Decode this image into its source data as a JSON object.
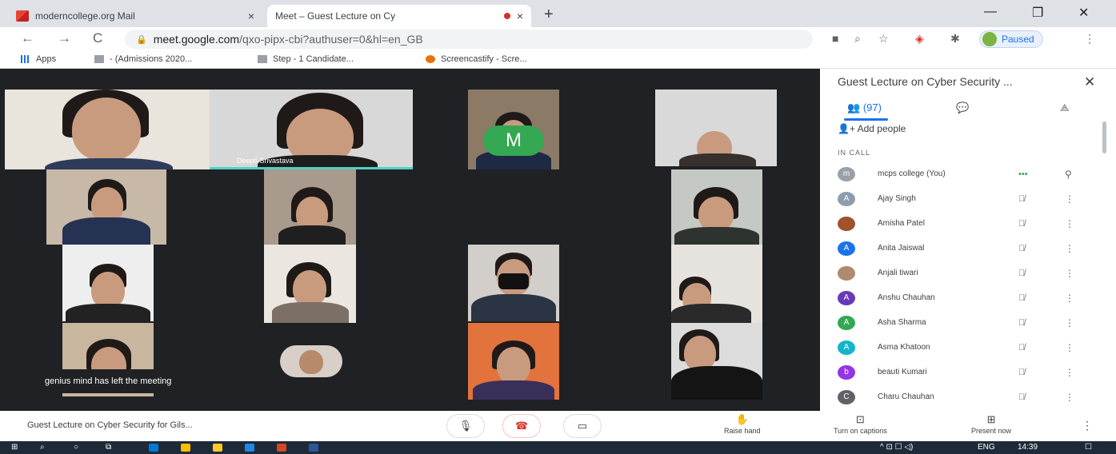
{
  "browser": {
    "tabs": [
      {
        "title": "moderncollege.org Mail",
        "close": "×"
      },
      {
        "title": "Meet – Guest Lecture on Cy",
        "close": "×"
      }
    ],
    "new_tab": "+",
    "window_controls": {
      "minimize": "—",
      "maximize": "❐",
      "close": "✕"
    },
    "nav": {
      "back": "←",
      "forward": "→",
      "reload": "C"
    },
    "url_host": "meet.google.com",
    "url_path": "/qxo-pipx-cbi?authuser=0&hl=en_GB",
    "profile_status": "Paused",
    "menu": "⋮",
    "bookmarks": [
      {
        "label": "Apps"
      },
      {
        "label": "- (Admissions 2020..."
      },
      {
        "label": "Step - 1 Candidate..."
      },
      {
        "label": "Screencastify - Scre..."
      }
    ]
  },
  "meet": {
    "speaker_name": "Deepti Srivastava",
    "avatar_letter": "M",
    "toast": "genius mind has left the meeting",
    "meeting_title": "Guest Lecture on Cyber Security for Gils...",
    "controls": {
      "mic": "🎙",
      "hangup": "☎",
      "camera": "▭"
    },
    "actions": [
      {
        "label": "Raise hand",
        "icon": "✋"
      },
      {
        "label": "Turn on captions",
        "icon": "⊡"
      },
      {
        "label": "Present now",
        "icon": "⊞"
      }
    ],
    "more_dots": "⋮"
  },
  "panel": {
    "title": "Guest Lecture on Cyber Security ...",
    "close": "✕",
    "people_count": "(97)",
    "add_people": "Add people",
    "in_call_label": "IN CALL",
    "participants": [
      {
        "initial": "m",
        "name": "mcps college (You)",
        "color": "#9aa0a6"
      },
      {
        "initial": "A",
        "name": "Ajay Singh",
        "color": "#8c9eae"
      },
      {
        "initial": "",
        "name": "Amisha Patel",
        "color": "#a0522d"
      },
      {
        "initial": "A",
        "name": "Anita Jaiswal",
        "color": "#1a73e8"
      },
      {
        "initial": "",
        "name": "Anjali tiwari",
        "color": "#b08a6e"
      },
      {
        "initial": "A",
        "name": "Anshu Chauhan",
        "color": "#673ab7"
      },
      {
        "initial": "A",
        "name": "Asha Sharma",
        "color": "#34a853"
      },
      {
        "initial": "A",
        "name": "Asma Khatoon",
        "color": "#12b5cb"
      },
      {
        "initial": "b",
        "name": "beauti Kumari",
        "color": "#9334e6"
      },
      {
        "initial": "C",
        "name": "Charu Chauhan",
        "color": "#5f6368"
      }
    ]
  },
  "taskbar": {
    "system": "^  ⊡  ☐  ◁)",
    "language": "ENG",
    "time": "14:39"
  }
}
